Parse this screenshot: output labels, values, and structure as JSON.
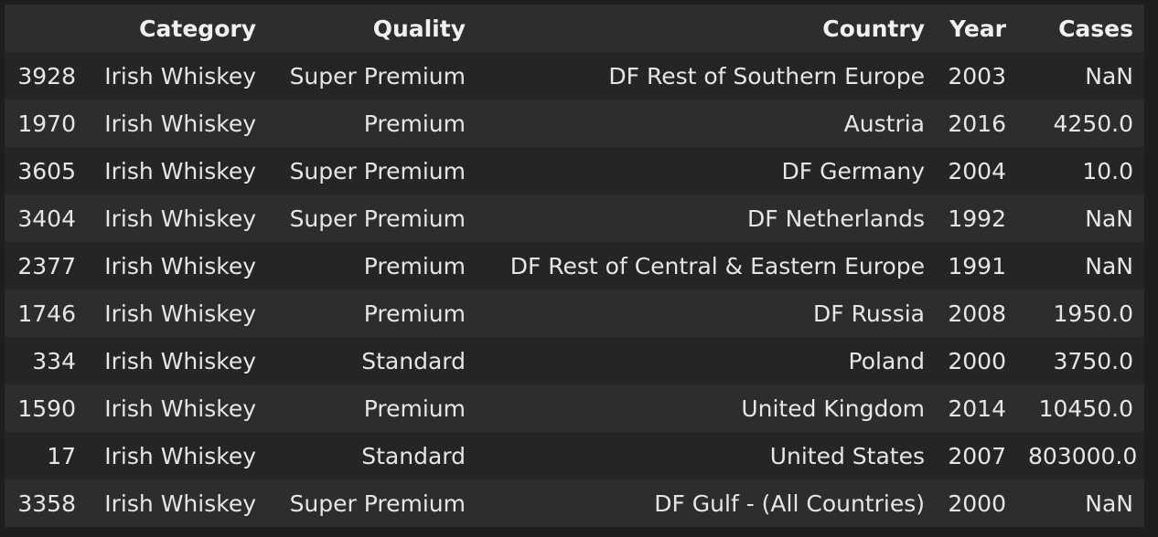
{
  "table": {
    "columns": [
      "",
      "Category",
      "Quality",
      "Country",
      "Year",
      "Cases"
    ],
    "rows": [
      {
        "index": "3928",
        "category": "Irish Whiskey",
        "quality": "Super Premium",
        "country": "DF Rest of Southern Europe",
        "year": "2003",
        "cases": "NaN"
      },
      {
        "index": "1970",
        "category": "Irish Whiskey",
        "quality": "Premium",
        "country": "Austria",
        "year": "2016",
        "cases": "4250.0"
      },
      {
        "index": "3605",
        "category": "Irish Whiskey",
        "quality": "Super Premium",
        "country": "DF Germany",
        "year": "2004",
        "cases": "10.0"
      },
      {
        "index": "3404",
        "category": "Irish Whiskey",
        "quality": "Super Premium",
        "country": "DF Netherlands",
        "year": "1992",
        "cases": "NaN"
      },
      {
        "index": "2377",
        "category": "Irish Whiskey",
        "quality": "Premium",
        "country": "DF Rest of Central & Eastern Europe",
        "year": "1991",
        "cases": "NaN"
      },
      {
        "index": "1746",
        "category": "Irish Whiskey",
        "quality": "Premium",
        "country": "DF Russia",
        "year": "2008",
        "cases": "1950.0"
      },
      {
        "index": "334",
        "category": "Irish Whiskey",
        "quality": "Standard",
        "country": "Poland",
        "year": "2000",
        "cases": "3750.0"
      },
      {
        "index": "1590",
        "category": "Irish Whiskey",
        "quality": "Premium",
        "country": "United Kingdom",
        "year": "2014",
        "cases": "10450.0"
      },
      {
        "index": "17",
        "category": "Irish Whiskey",
        "quality": "Standard",
        "country": "United States",
        "year": "2007",
        "cases": "803000.0"
      },
      {
        "index": "3358",
        "category": "Irish Whiskey",
        "quality": "Super Premium",
        "country": "DF Gulf - (All Countries)",
        "year": "2000",
        "cases": "NaN"
      }
    ]
  }
}
